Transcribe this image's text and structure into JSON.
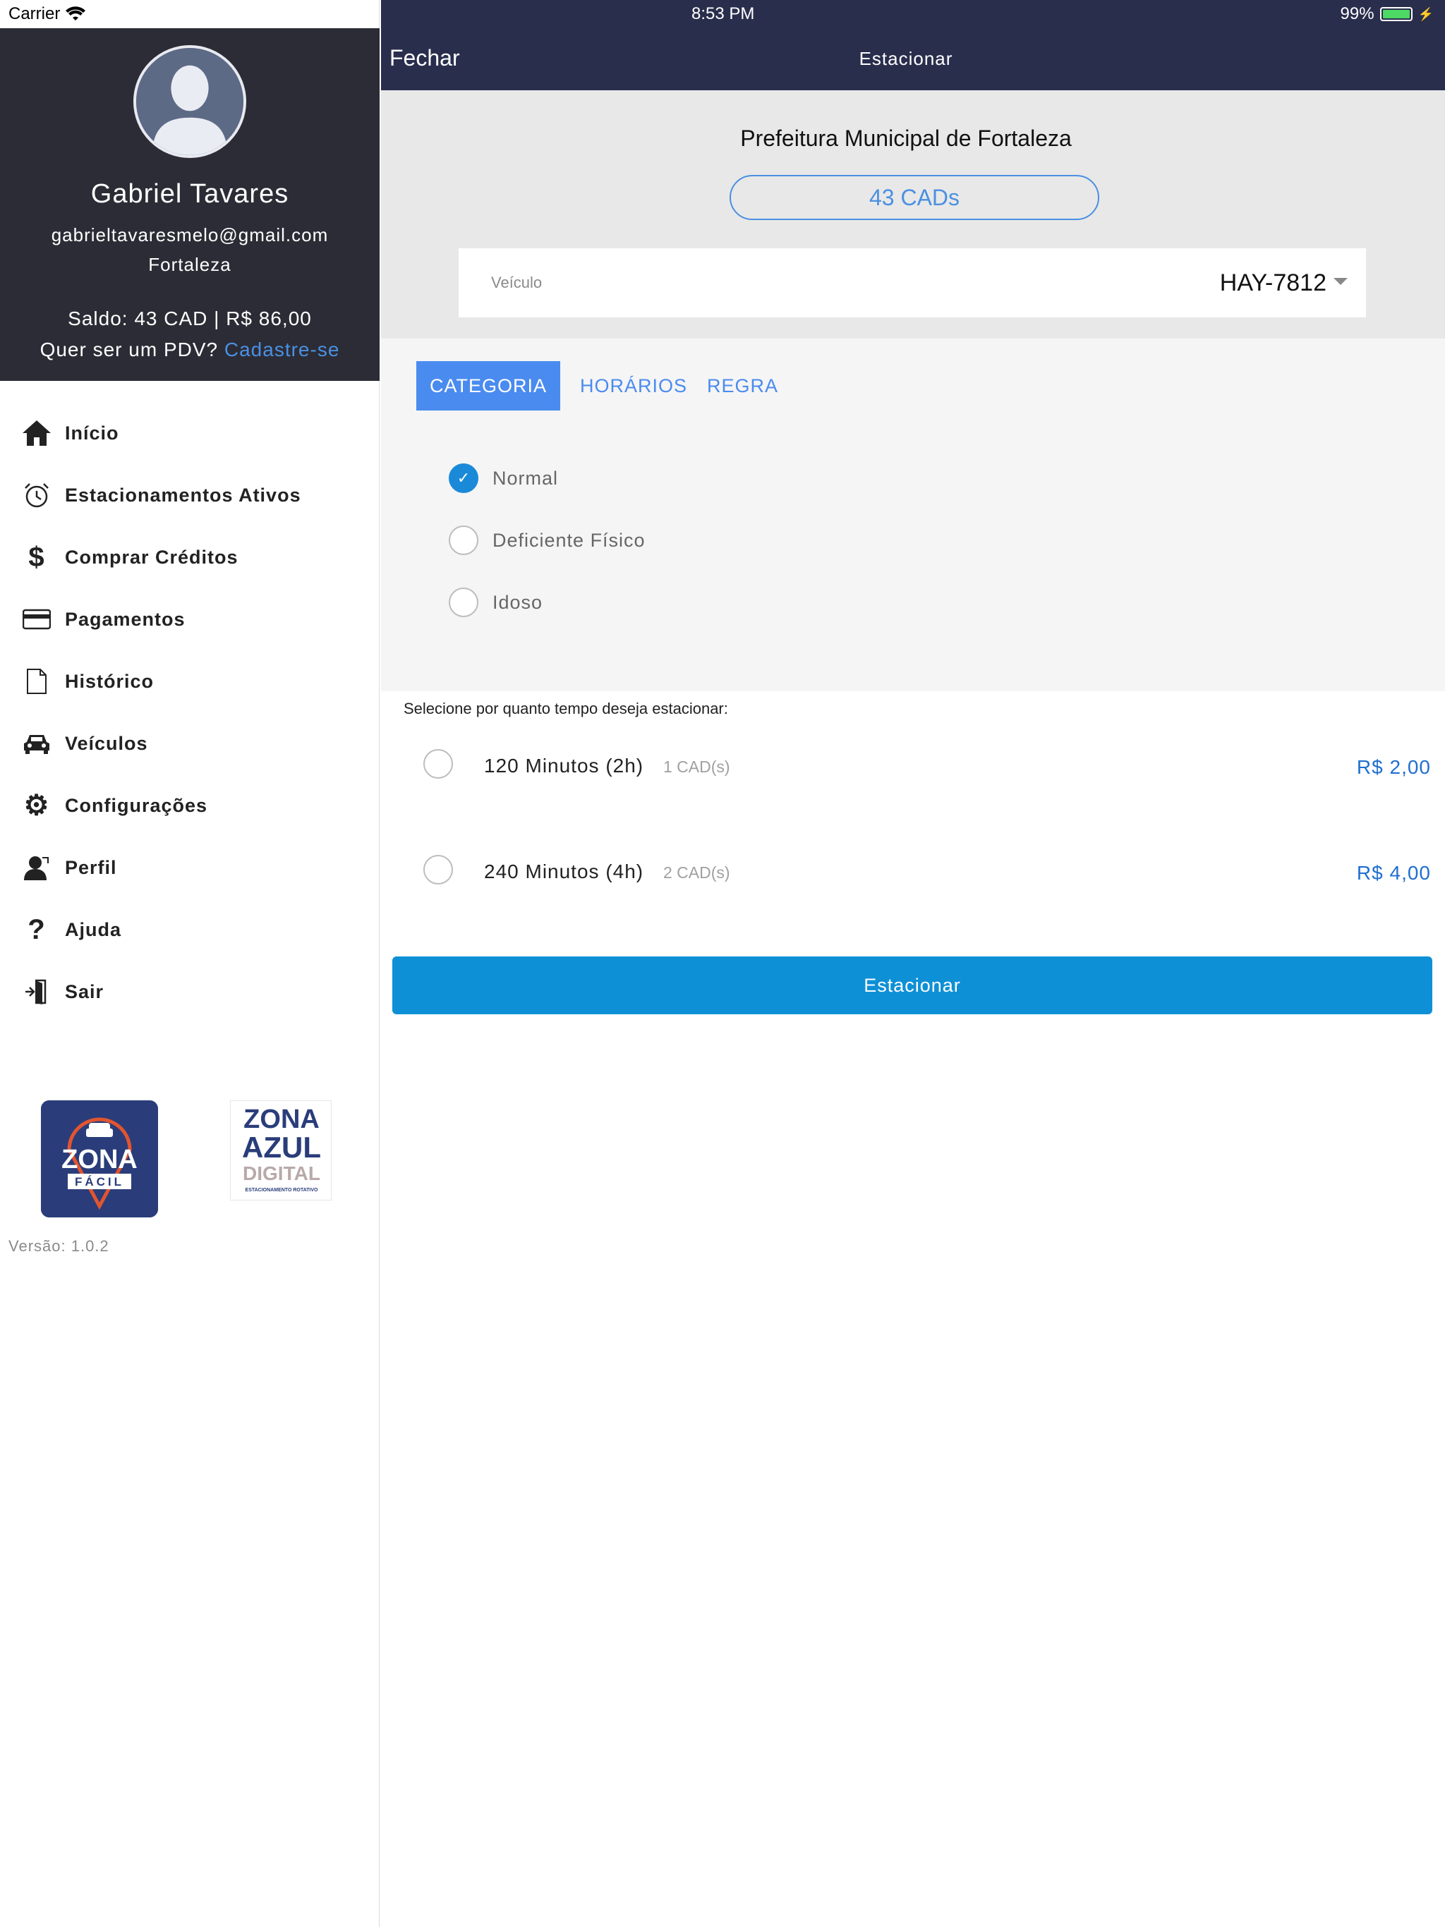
{
  "status": {
    "carrier": "Carrier",
    "time": "8:53 PM",
    "battery": "99%"
  },
  "profile": {
    "name": "Gabriel Tavares",
    "email": "gabrieltavaresmelo@gmail.com",
    "city": "Fortaleza",
    "saldo": "Saldo: 43 CAD | R$ 86,00",
    "pdv_question": "Quer ser um PDV?",
    "pdv_link": "Cadastre-se"
  },
  "menu": {
    "items": [
      {
        "label": "Início",
        "icon": "home-icon"
      },
      {
        "label": "Estacionamentos Ativos",
        "icon": "alarm-clock-icon"
      },
      {
        "label": "Comprar Créditos",
        "icon": "dollar-icon"
      },
      {
        "label": "Pagamentos",
        "icon": "credit-card-icon"
      },
      {
        "label": "Histórico",
        "icon": "document-icon"
      },
      {
        "label": "Veículos",
        "icon": "car-icon"
      },
      {
        "label": "Configurações",
        "icon": "gear-icon"
      },
      {
        "label": "Perfil",
        "icon": "user-icon"
      },
      {
        "label": "Ajuda",
        "icon": "question-icon"
      },
      {
        "label": "Sair",
        "icon": "exit-icon"
      }
    ]
  },
  "logos": {
    "zona_facil": {
      "line1": "ZONA",
      "line2": "FÁCIL"
    },
    "zona_azul": {
      "line1": "ZONA",
      "line2": "AZUL",
      "line3": "DIGITAL",
      "line4": "ESTACIONAMENTO ROTATIVO"
    }
  },
  "version": "Versão: 1.0.2",
  "navbar": {
    "close": "Fechar",
    "title": "Estacionar"
  },
  "header": {
    "prefeitura": "Prefeitura Municipal de Fortaleza",
    "cads": "43 CADs",
    "vehicle_label": "Veículo",
    "vehicle_value": "HAY-7812"
  },
  "tabs": {
    "categoria": "CATEGORIA",
    "horarios": "HORÁRIOS",
    "regra": "REGRA"
  },
  "categories": [
    {
      "label": "Normal",
      "checked": true
    },
    {
      "label": "Deficiente Físico",
      "checked": false
    },
    {
      "label": "Idoso",
      "checked": false
    }
  ],
  "time_hint": "Selecione por quanto tempo deseja estacionar:",
  "options": [
    {
      "label": "120 Minutos (2h)",
      "cads": "1 CAD(s)",
      "price": "R$ 2,00"
    },
    {
      "label": "240 Minutos (4h)",
      "cads": "2 CAD(s)",
      "price": "R$ 4,00"
    }
  ],
  "park_button": "Estacionar",
  "colors": {
    "sidebar_header": "#2c2c36",
    "navbar": "#2a2e4d",
    "accent": "#4a8bef",
    "button": "#0e90d6"
  }
}
